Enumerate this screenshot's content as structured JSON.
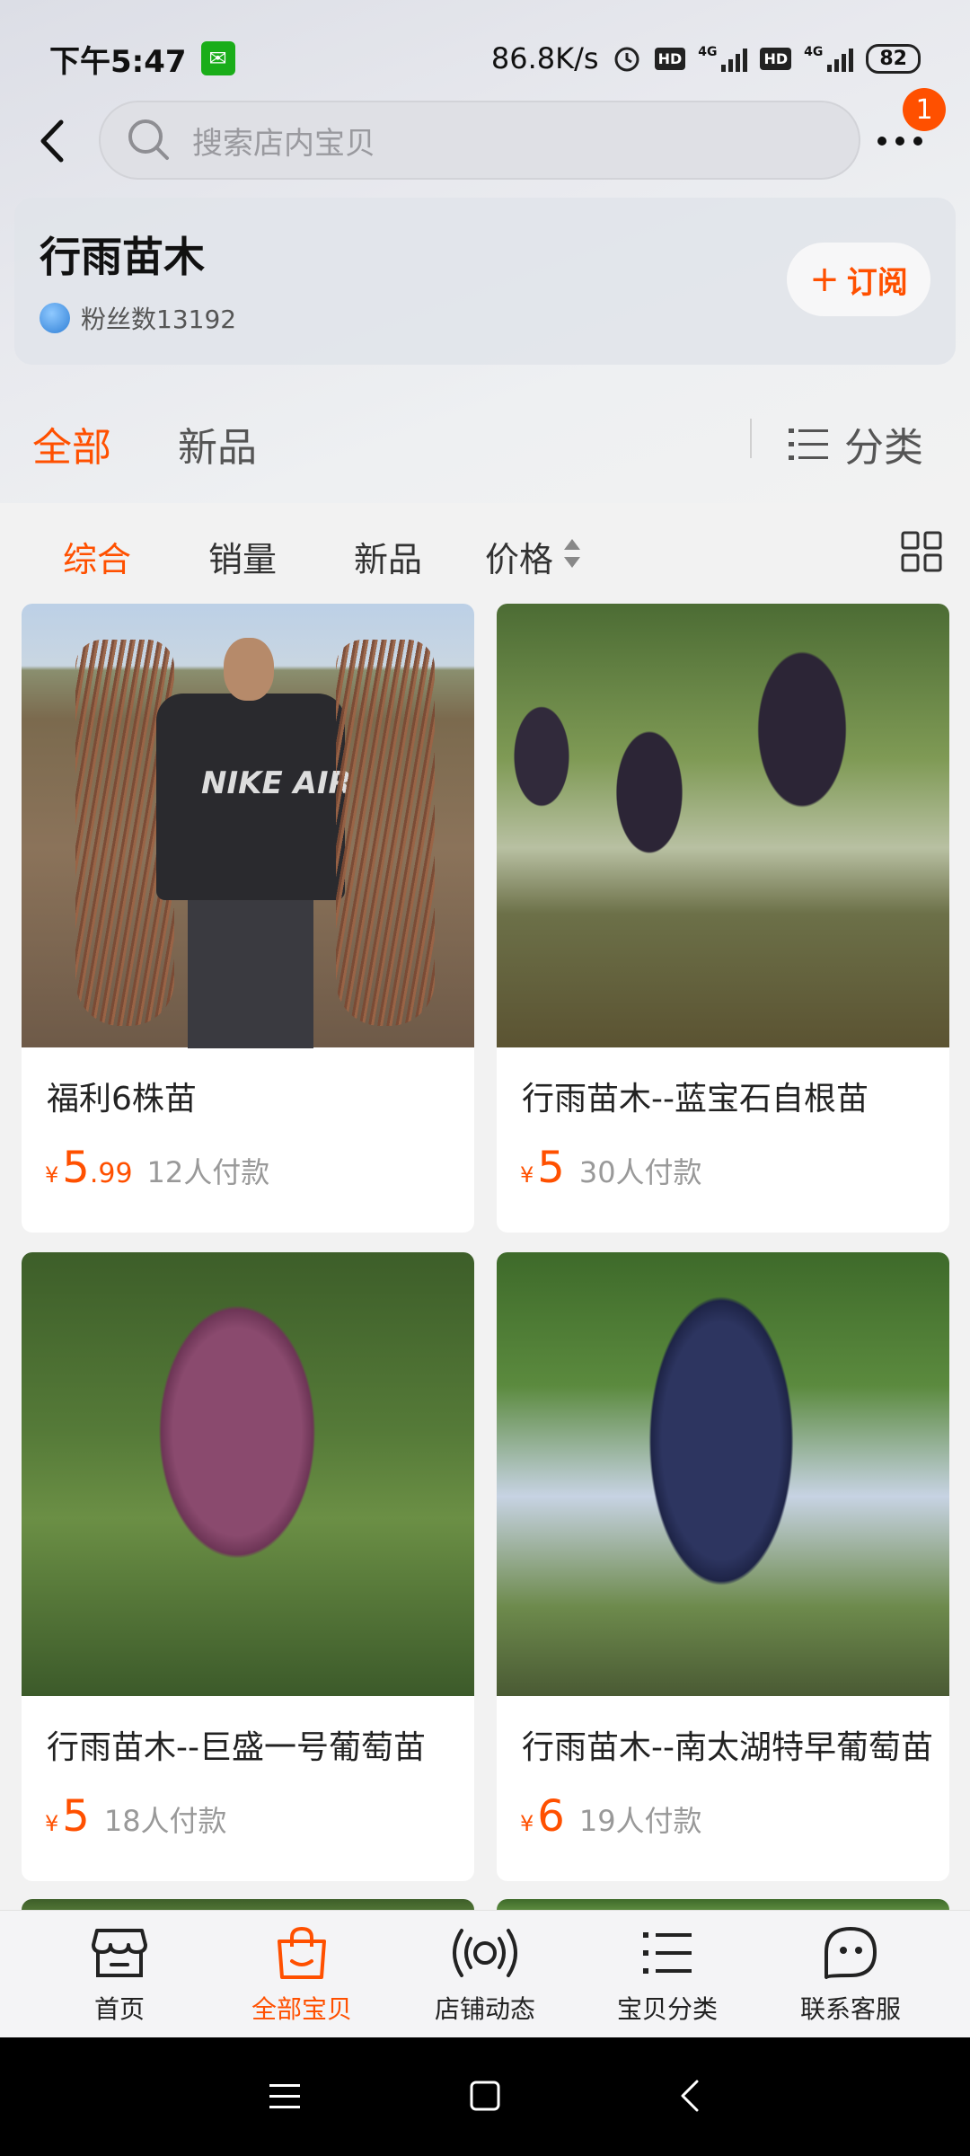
{
  "status_bar": {
    "time": "下午5:47",
    "net_speed": "86.8K/s",
    "hd1": "HD",
    "hd2": "HD",
    "net_type": "4G",
    "battery": "82"
  },
  "header": {
    "search_placeholder": "搜索店内宝贝",
    "message_badge": "1"
  },
  "shop": {
    "name": "行雨苗木",
    "fans_label": "粉丝数13192",
    "subscribe_label": "订阅",
    "subscribe_icon": "+"
  },
  "tabs": {
    "all": "全部",
    "new": "新品",
    "category": "分类"
  },
  "sort": {
    "comprehensive": "综合",
    "sales": "销量",
    "new": "新品",
    "price": "价格"
  },
  "products": [
    {
      "title": "福利6株苗",
      "yen": "¥",
      "price_int": "5",
      "price_dec": ".99",
      "sold": "12人付款"
    },
    {
      "title": "行雨苗木--蓝宝石自根苗",
      "yen": "¥",
      "price_int": "5",
      "price_dec": "",
      "sold": "30人付款"
    },
    {
      "title": "行雨苗木--巨盛一号葡萄苗",
      "yen": "¥",
      "price_int": "5",
      "price_dec": "",
      "sold": "18人付款"
    },
    {
      "title": "行雨苗木--南太湖特早葡萄苗",
      "yen": "¥",
      "price_int": "6",
      "price_dec": "",
      "sold": "19人付款"
    }
  ],
  "photo_text": {
    "shirt": "NIKE AIR"
  },
  "bottom_nav": [
    {
      "label": "首页",
      "icon": "store-icon"
    },
    {
      "label": "全部宝贝",
      "icon": "bag-icon"
    },
    {
      "label": "店铺动态",
      "icon": "broadcast-icon"
    },
    {
      "label": "宝贝分类",
      "icon": "list-icon"
    },
    {
      "label": "联系客服",
      "icon": "chat-icon"
    }
  ],
  "colors": {
    "accent": "#ff5000"
  }
}
